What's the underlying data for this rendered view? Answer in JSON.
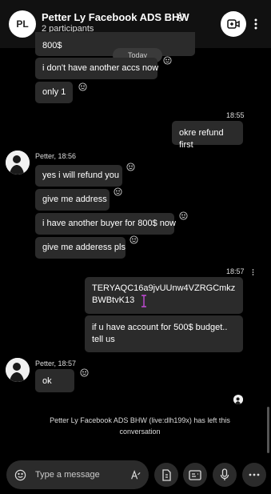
{
  "header": {
    "initials": "PL",
    "title": "Petter Ly Facebook ADS BHW",
    "subtitle": "2 participants"
  },
  "date_divider": "Today",
  "messages": {
    "top_partial": "800$",
    "no_other_accs": "i don't have another accs now",
    "only_one": "only 1",
    "time_1": "18:55",
    "okre": "okre refund first",
    "sender_1": "Petter, 18:56",
    "refund": "yes i will refund you",
    "address": "give me address",
    "buyer": "i have another buyer for 800$ now",
    "address_pls": "give me adderess pls",
    "time_2": "18:57",
    "key": "TERYAQC16a9jvUUnw4VZRGCmkzBWBtvK13",
    "budget": "if u have account for 500$ budget.. tell us",
    "sender_2": "Petter, 18:57",
    "ok": "ok"
  },
  "system_message": "Petter Ly Facebook ADS BHW (live:dlh199x) has left this conversation",
  "composer": {
    "placeholder": "Type a message"
  },
  "colors": {
    "background": "#000000",
    "bubble": "#2b2b2b",
    "header": "#111111"
  }
}
